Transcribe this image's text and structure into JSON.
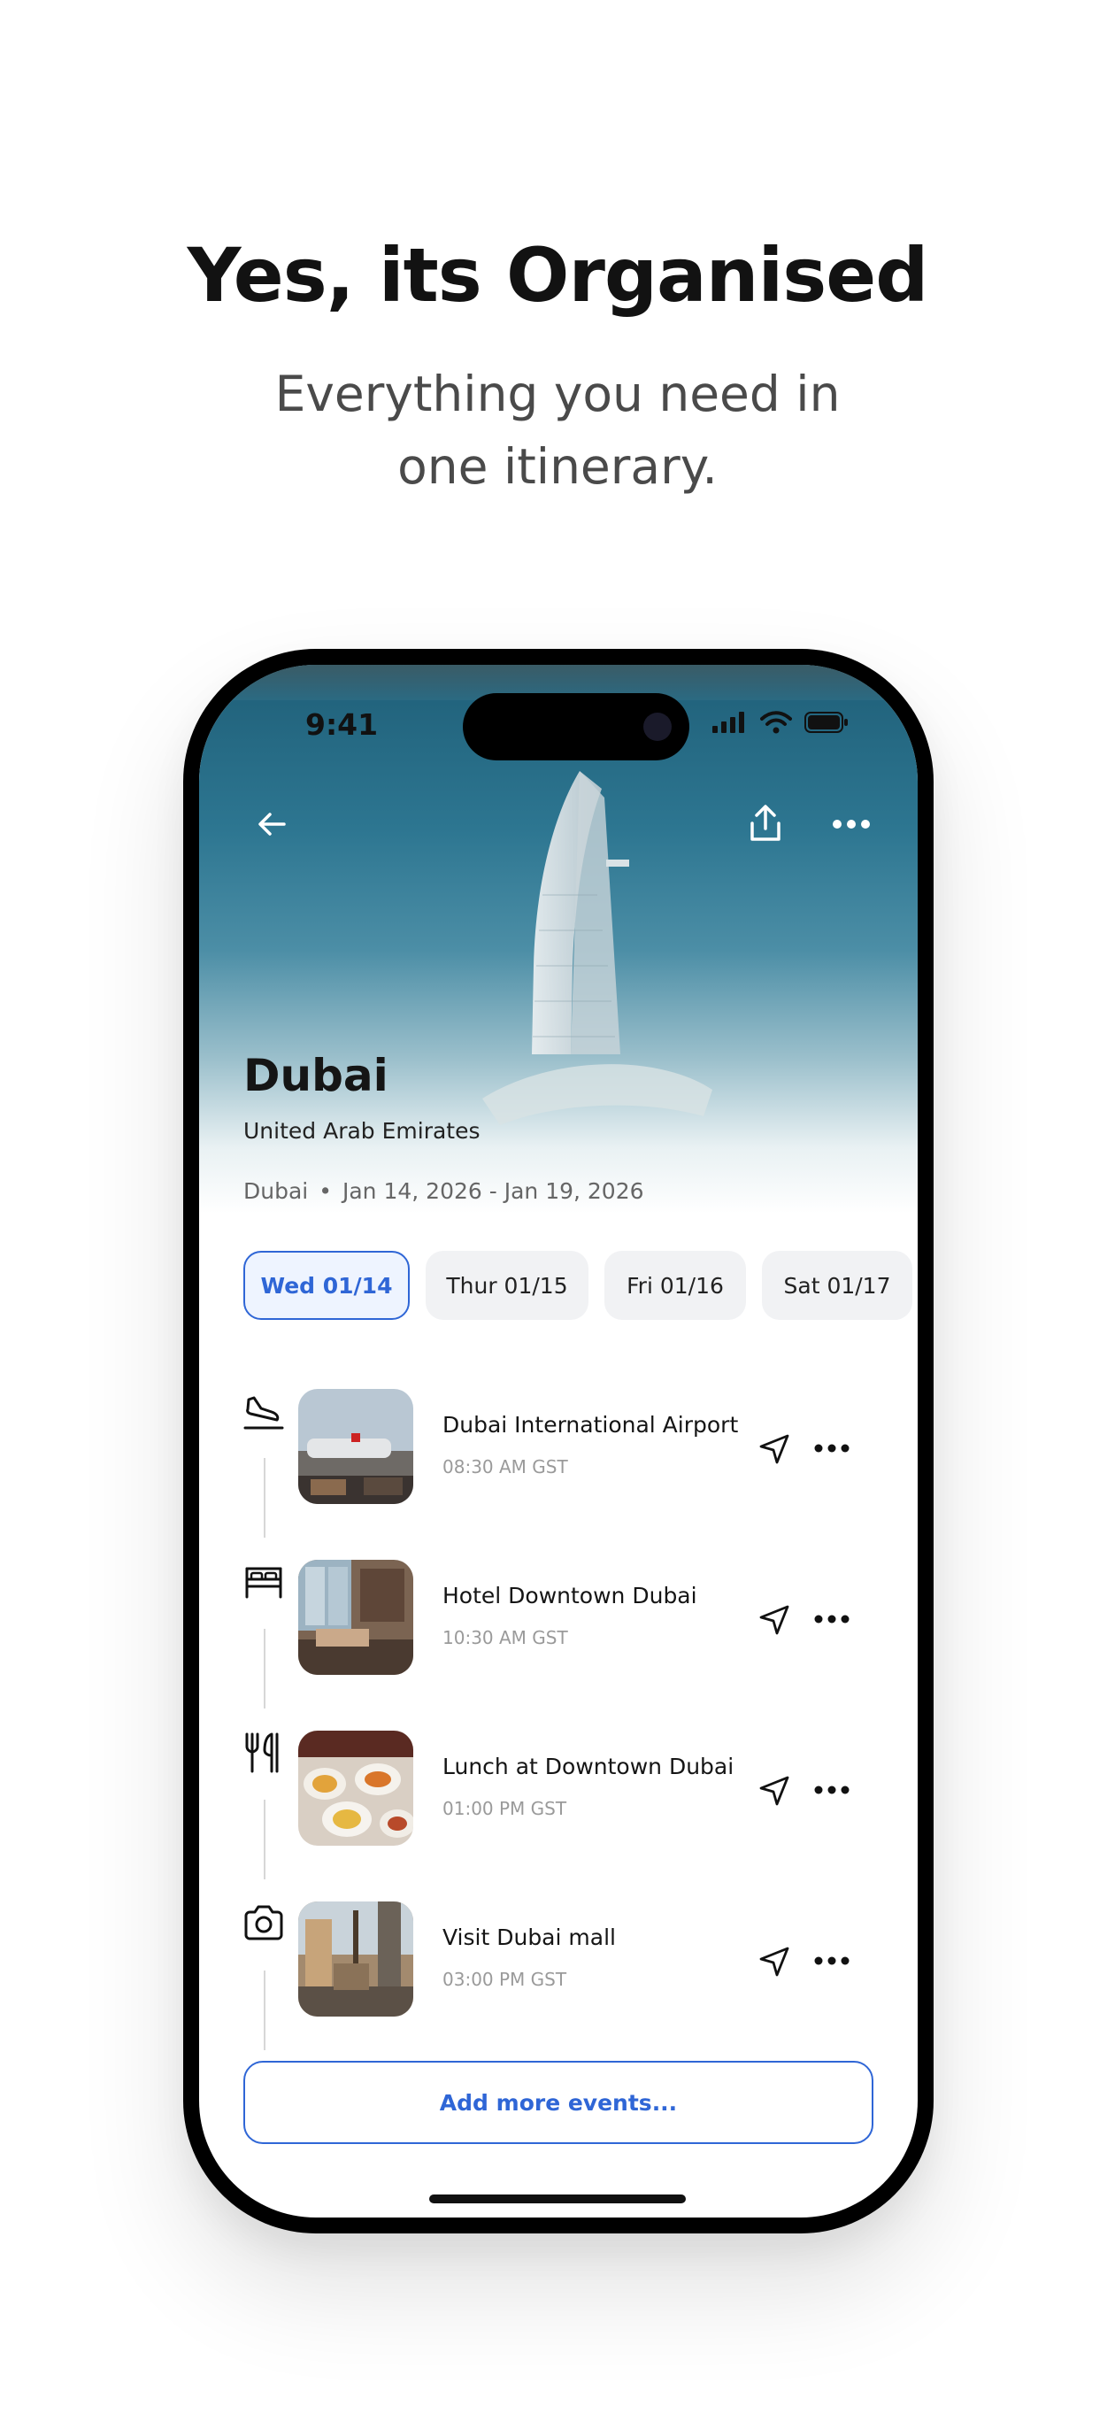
{
  "marketing": {
    "headline": "Yes, its Organised",
    "subhead_line1": "Everything you need in",
    "subhead_line2": "one itinerary."
  },
  "status_bar": {
    "time": "9:41"
  },
  "trip": {
    "city": "Dubai",
    "country": "United Arab Emirates",
    "location": "Dubai",
    "date_range": "Jan 14, 2026 - Jan 19, 2026"
  },
  "day_tabs": [
    {
      "label": "Wed 01/14",
      "active": true
    },
    {
      "label": "Thur 01/15",
      "active": false
    },
    {
      "label": "Fri 01/16",
      "active": false
    },
    {
      "label": "Sat 01/17",
      "active": false
    }
  ],
  "events": [
    {
      "title": "Dubai International Airport",
      "time": "08:30 AM GST",
      "icon": "plane-landing-icon"
    },
    {
      "title": "Hotel Downtown Dubai",
      "time": "10:30 AM GST",
      "icon": "bed-icon"
    },
    {
      "title": "Lunch at Downtown Dubai",
      "time": "01:00 PM GST",
      "icon": "fork-knife-icon"
    },
    {
      "title": "Visit Dubai mall",
      "time": "03:00 PM GST",
      "icon": "camera-icon"
    }
  ],
  "add_button_label": "Add more events...",
  "colors": {
    "accent": "#2f66d6",
    "active_tab_bg": "#eef4ff",
    "tab_bg": "#f1f2f4",
    "hero_sea": "#2d7691"
  }
}
